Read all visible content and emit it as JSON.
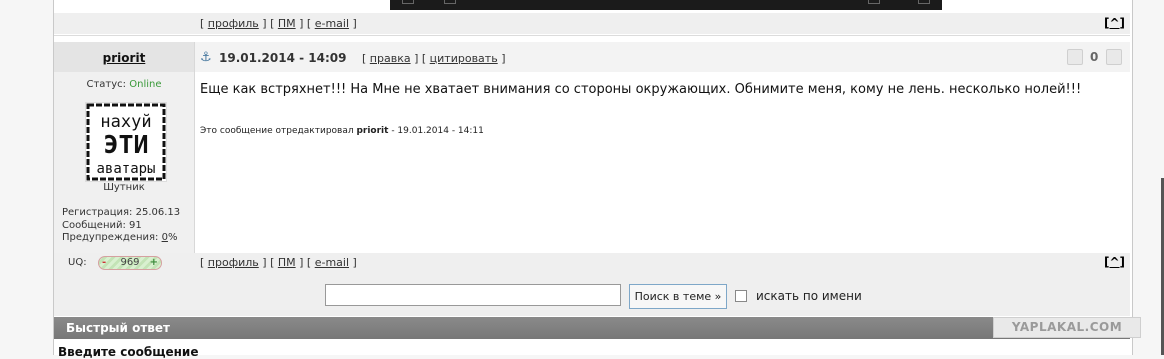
{
  "post_top": {
    "links": [
      "профиль",
      "ПМ",
      "e-mail"
    ],
    "totop": "^"
  },
  "post": {
    "author": "priorit",
    "date": "19.01.2014 - 14:09",
    "actions": [
      "правка",
      "цитировать"
    ],
    "rating": "0",
    "status_label": "Статус:",
    "status_value": "Online",
    "avatar_text": [
      "нахуй",
      "ЭТИ",
      "аватары"
    ],
    "rank": "Шутник",
    "registration": "Регистрация: 25.06.13",
    "messages": "Сообщений: 91",
    "warnings_label": "Предупреждения: ",
    "warnings_value": "0",
    "warnings_suffix": "%",
    "message": "Еще как встряхнет!!! На Мне не хватает внимания со стороны окружающих. Обнимите меня, кому не лень. несколько нолей!!!",
    "edited_prefix": "Это сообщение отредактировал ",
    "edited_user": "priorit",
    "edited_suffix": " - 19.01.2014 - 14:11",
    "uq_label": "UQ:",
    "uq_value": "969",
    "uq_minus": "-",
    "uq_plus": "+",
    "links": [
      "профиль",
      "ПМ",
      "e-mail"
    ],
    "totop": "^"
  },
  "search": {
    "value": "",
    "button": "Поиск в теме »",
    "checkbox_label": "искать по имени"
  },
  "quick_reply": {
    "title": "Быстрый ответ",
    "logo": "YAPLAKAL.COM",
    "message_label": "Введите сообщение"
  }
}
